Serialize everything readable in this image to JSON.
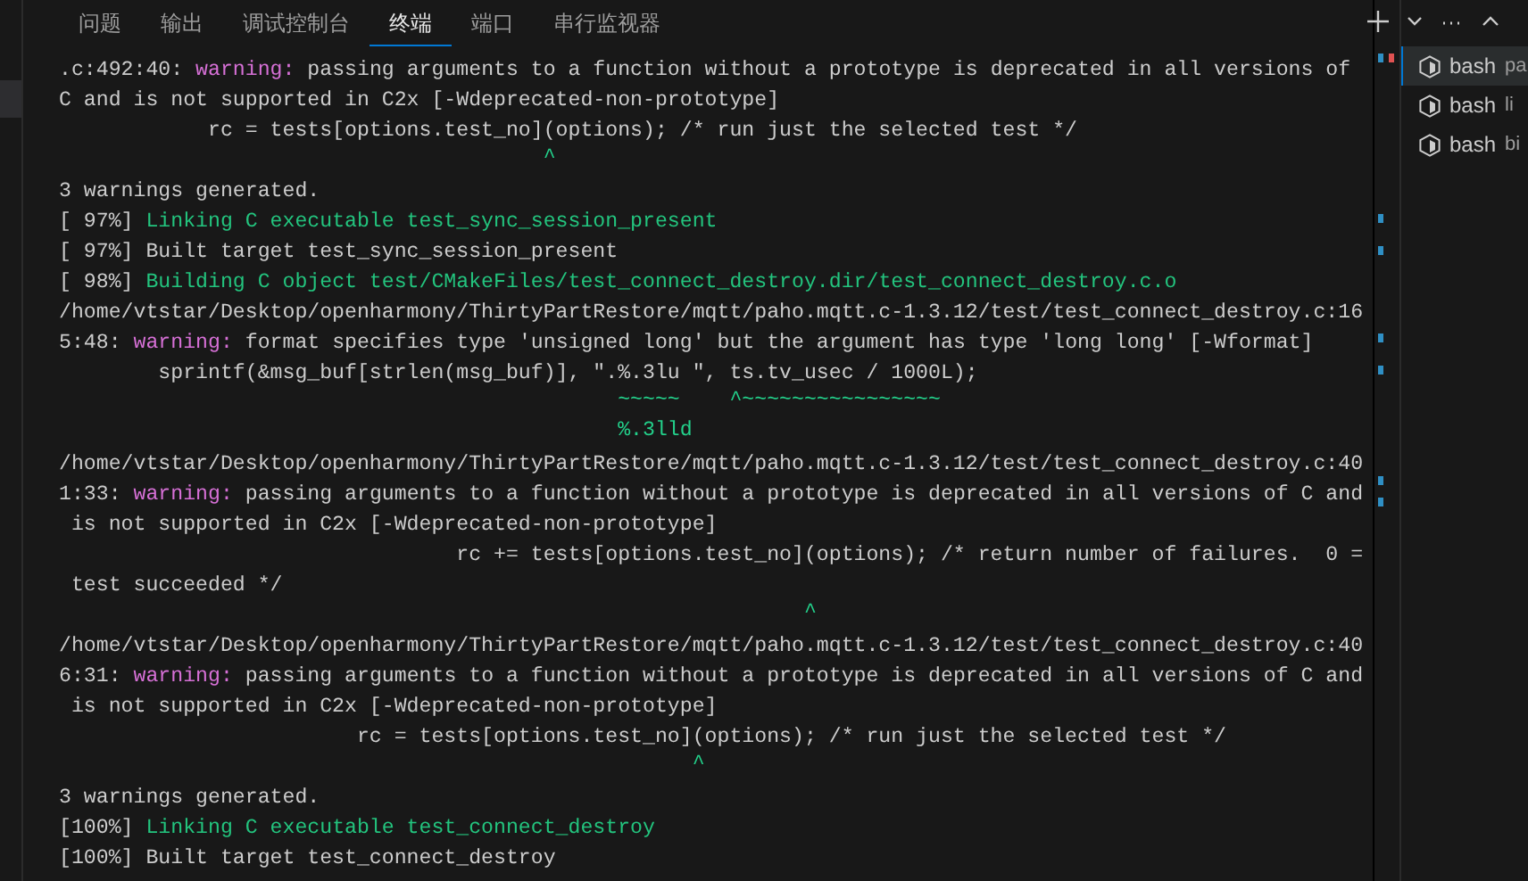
{
  "panel_tabs": [
    {
      "label": "问题",
      "selected": false
    },
    {
      "label": "输出",
      "selected": false
    },
    {
      "label": "调试控制台",
      "selected": false
    },
    {
      "label": "终端",
      "selected": true
    },
    {
      "label": "端口",
      "selected": false
    },
    {
      "label": "串行监视器",
      "selected": false
    }
  ],
  "terminal_lines": [
    [
      {
        "kind": "plain",
        "text": ".c:492:40: "
      },
      {
        "kind": "warning",
        "text": "warning:"
      },
      {
        "kind": "plain",
        "text": " passing arguments to a function without a prototype is deprecated in all versions of"
      }
    ],
    [
      {
        "kind": "plain",
        "text": "C and is not supported in C2x [-Wdeprecated-non-prototype]"
      }
    ],
    [
      {
        "kind": "plain",
        "text": "            rc = tests[options.test_no](options); /* run just the selected test */"
      }
    ],
    [
      {
        "kind": "caret",
        "text": "                                       ^"
      }
    ],
    [
      {
        "kind": "plain",
        "text": "3 warnings generated."
      }
    ],
    [
      {
        "kind": "plain",
        "text": "[ 97%] "
      },
      {
        "kind": "green",
        "text": "Linking C executable test_sync_session_present"
      }
    ],
    [
      {
        "kind": "plain",
        "text": "[ 97%] Built target test_sync_session_present"
      }
    ],
    [
      {
        "kind": "plain",
        "text": "[ 98%] "
      },
      {
        "kind": "green",
        "text": "Building C object test/CMakeFiles/test_connect_destroy.dir/test_connect_destroy.c.o"
      }
    ],
    [
      {
        "kind": "plain",
        "text": "/home/vtstar/Desktop/openharmony/ThirtyPartRestore/mqtt/paho.mqtt.c-1.3.12/test/test_connect_destroy.c:16"
      }
    ],
    [
      {
        "kind": "plain",
        "text": "5:48: "
      },
      {
        "kind": "warning",
        "text": "warning:"
      },
      {
        "kind": "plain",
        "text": " format specifies type 'unsigned long' but the argument has type 'long long' [-Wformat]"
      }
    ],
    [
      {
        "kind": "plain",
        "text": "        sprintf(&msg_buf[strlen(msg_buf)], \".%.3lu \", ts.tv_usec / 1000L);"
      }
    ],
    [
      {
        "kind": "caret",
        "text": "                                             ~~~~~    ^~~~~~~~~~~~~~~~~"
      }
    ],
    [
      {
        "kind": "caret",
        "text": "                                             %.3lld"
      }
    ],
    [
      {
        "kind": "plain",
        "text": "/home/vtstar/Desktop/openharmony/ThirtyPartRestore/mqtt/paho.mqtt.c-1.3.12/test/test_connect_destroy.c:40"
      }
    ],
    [
      {
        "kind": "plain",
        "text": "1:33: "
      },
      {
        "kind": "warning",
        "text": "warning:"
      },
      {
        "kind": "plain",
        "text": " passing arguments to a function without a prototype is deprecated in all versions of C and"
      }
    ],
    [
      {
        "kind": "plain",
        "text": " is not supported in C2x [-Wdeprecated-non-prototype]"
      }
    ],
    [
      {
        "kind": "plain",
        "text": "                                rc += tests[options.test_no](options); /* return number of failures.  0 ="
      }
    ],
    [
      {
        "kind": "plain",
        "text": " test succeeded */"
      }
    ],
    [
      {
        "kind": "caret",
        "text": "                                                            ^"
      }
    ],
    [
      {
        "kind": "plain",
        "text": "/home/vtstar/Desktop/openharmony/ThirtyPartRestore/mqtt/paho.mqtt.c-1.3.12/test/test_connect_destroy.c:40"
      }
    ],
    [
      {
        "kind": "plain",
        "text": "6:31: "
      },
      {
        "kind": "warning",
        "text": "warning:"
      },
      {
        "kind": "plain",
        "text": " passing arguments to a function without a prototype is deprecated in all versions of C and"
      }
    ],
    [
      {
        "kind": "plain",
        "text": " is not supported in C2x [-Wdeprecated-non-prototype]"
      }
    ],
    [
      {
        "kind": "plain",
        "text": "                        rc = tests[options.test_no](options); /* run just the selected test */"
      }
    ],
    [
      {
        "kind": "caret",
        "text": "                                                   ^"
      }
    ],
    [
      {
        "kind": "plain",
        "text": "3 warnings generated."
      }
    ],
    [
      {
        "kind": "plain",
        "text": "[100%] "
      },
      {
        "kind": "green",
        "text": "Linking C executable test_connect_destroy"
      }
    ],
    [
      {
        "kind": "plain",
        "text": "[100%] Built target test_connect_destroy"
      }
    ]
  ],
  "terminals": [
    {
      "name": "bash",
      "detail": "pa",
      "selected": true
    },
    {
      "name": "bash",
      "detail": "li",
      "selected": false
    },
    {
      "name": "bash",
      "detail": "bi",
      "selected": false
    }
  ]
}
